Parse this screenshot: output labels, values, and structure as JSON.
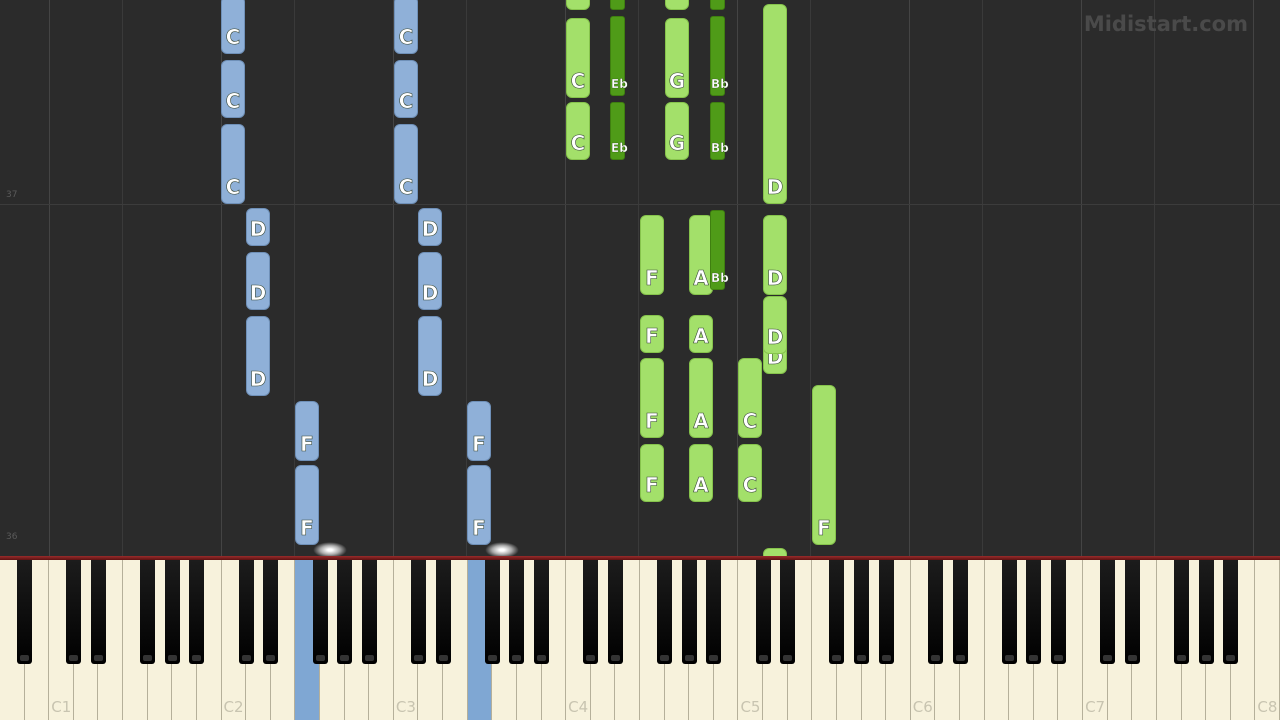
{
  "app": {
    "watermark": "Midistart.com"
  },
  "measures": [
    "37",
    "36"
  ],
  "octave_labels": [
    "C1",
    "C2",
    "C3",
    "C4",
    "C5",
    "C6",
    "C7",
    "C8"
  ],
  "notes_left_hand": [
    "C",
    "C",
    "C",
    "D",
    "D",
    "D",
    "F",
    "F",
    "C",
    "C",
    "C",
    "D",
    "D",
    "D",
    "F",
    "F"
  ],
  "notes_right_hand": [
    "C",
    "C",
    "Eb",
    "Eb",
    "G",
    "G",
    "Bb",
    "Bb",
    "D",
    "F",
    "A",
    "Bb",
    "D",
    "F",
    "A",
    "D",
    "D",
    "F",
    "A",
    "C",
    "F",
    "A",
    "C",
    "F"
  ],
  "active_keys": [
    "F2",
    "F3"
  ],
  "colors": {
    "left_hand": "#8fb0d8",
    "right_hand": "#a3e06a",
    "right_hand_black": "#4f9b18",
    "active_key": "#7fa7d3",
    "background": "#2b2b2b"
  }
}
